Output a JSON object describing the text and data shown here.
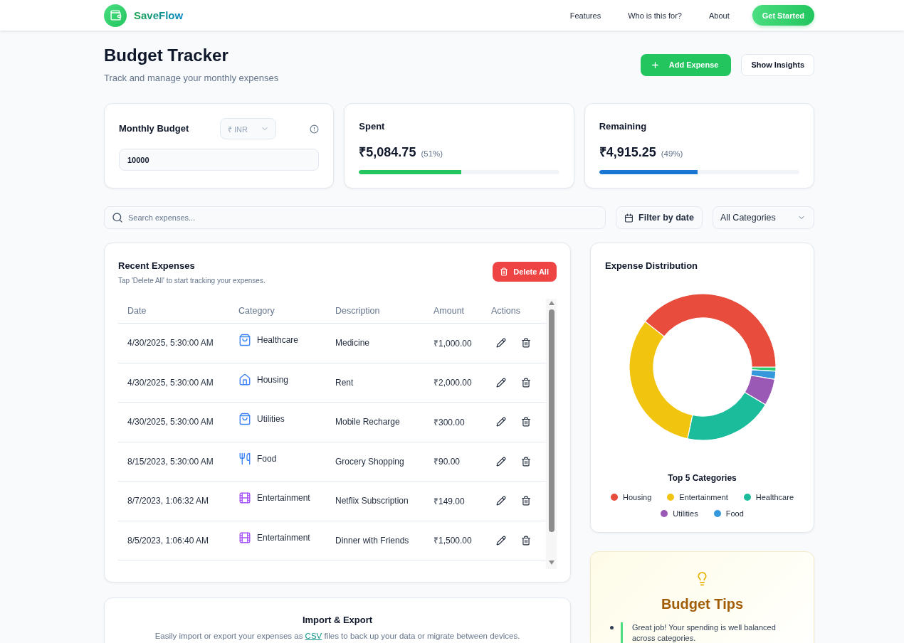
{
  "brand": {
    "name": "SaveFlow"
  },
  "nav": {
    "links": [
      "Features",
      "Who is this for?",
      "About"
    ],
    "cta": "Get Started"
  },
  "header": {
    "title": "Budget Tracker",
    "subtitle": "Track and manage your monthly expenses",
    "buttons": [
      {
        "label": "Add Expense",
        "kind": "primary"
      },
      {
        "label": "Show Insights",
        "kind": "secondary"
      }
    ]
  },
  "budget": {
    "label": "Monthly Budget",
    "currency": {
      "value": "₹ INR",
      "disabled": true
    },
    "value": "10000"
  },
  "stats": [
    {
      "label": "Spent",
      "amount": "₹5,084.75",
      "percent": "(51%)",
      "level": 0.51,
      "kind": "spent"
    },
    {
      "label": "Remaining",
      "amount": "₹4,915.25",
      "percent": "(49%)",
      "level": 0.49,
      "kind": "remaining"
    }
  ],
  "filters": {
    "search": {
      "placeholder": "Search expenses..."
    },
    "date_button": "Filter by date",
    "category": {
      "value": "All Categories"
    }
  },
  "expenses": {
    "title": "Recent Expenses",
    "hint": "Tap 'Delete All' to start tracking your expenses.",
    "delete_all": "Delete All",
    "columns": [
      "Date",
      "Category",
      "Description",
      "Amount",
      "Actions"
    ],
    "rows": [
      {
        "date": "4/30/2025, 5:30:00 AM",
        "category": "Healthcare",
        "kind": "healthcare",
        "description": "Medicine",
        "amount": "₹1,000.00"
      },
      {
        "date": "4/30/2025, 5:30:00 AM",
        "category": "Housing",
        "kind": "housing",
        "description": "Rent",
        "amount": "₹2,000.00"
      },
      {
        "date": "4/30/2025, 5:30:00 AM",
        "category": "Utilities",
        "kind": "utilities",
        "description": "Mobile Recharge",
        "amount": "₹300.00"
      },
      {
        "date": "8/15/2023, 5:30:00 AM",
        "category": "Food",
        "kind": "food",
        "description": "Grocery Shopping",
        "amount": "₹90.00"
      },
      {
        "date": "8/7/2023, 1:06:32 AM",
        "category": "Entertainment",
        "kind": "entertainment",
        "description": "Netflix Subscription",
        "amount": "₹149.00"
      },
      {
        "date": "8/5/2023, 1:06:40 AM",
        "category": "Entertainment",
        "kind": "entertainment",
        "description": "Dinner with Friends",
        "amount": "₹1,500.00"
      }
    ]
  },
  "distribution": {
    "title": "Expense Distribution",
    "legend_title": "Top 5 Categories",
    "legend": [
      {
        "label": "Housing",
        "color": "#e74c3c"
      },
      {
        "label": "Entertainment",
        "color": "#f1c40f"
      },
      {
        "label": "Healthcare",
        "color": "#1abc9c"
      },
      {
        "label": "Utilities",
        "color": "#9b59b6"
      },
      {
        "label": "Food",
        "color": "#3498db"
      }
    ]
  },
  "tips": {
    "title": "Budget Tips",
    "items": [
      "Great job! Your spending is well balanced across categories."
    ]
  },
  "import_export": {
    "title": "Import & Export",
    "description": {
      "before": "Easily import or export your expenses as",
      "link": "CSV",
      "after": "files to back up your data or migrate between devices."
    }
  }
}
